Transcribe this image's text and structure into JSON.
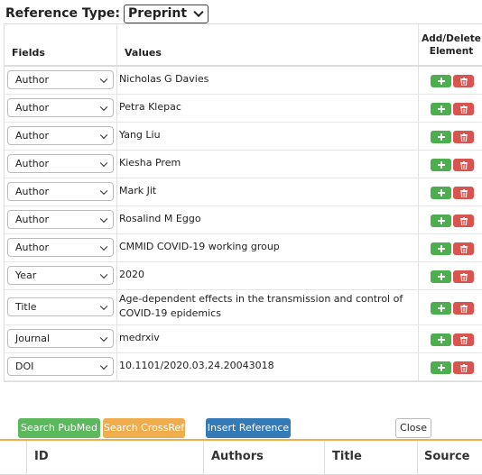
{
  "reference_type": {
    "label": "Reference Type:",
    "selected": "Preprint"
  },
  "table": {
    "headers": {
      "fields": "Fields",
      "values": "Values",
      "add_delete": "Add/Delete Element"
    },
    "rows": [
      {
        "field": "Author",
        "value": "Nicholas G Davies"
      },
      {
        "field": "Author",
        "value": "Petra Klepac"
      },
      {
        "field": "Author",
        "value": "Yang Liu"
      },
      {
        "field": "Author",
        "value": "Kiesha Prem"
      },
      {
        "field": "Author",
        "value": "Mark Jit"
      },
      {
        "field": "Author",
        "value": "Rosalind M Eggo"
      },
      {
        "field": "Author",
        "value": "CMMID COVID-19 working group"
      },
      {
        "field": "Year",
        "value": "2020"
      },
      {
        "field": "Title",
        "value": "Age-dependent effects in the transmission and control of COVID-19 epidemics"
      },
      {
        "field": "Journal",
        "value": "medrxiv"
      },
      {
        "field": "DOI",
        "value": "10.1101/2020.03.24.20043018"
      }
    ]
  },
  "buttons": {
    "search_pubmed": "Search PubMed",
    "search_crossref": "Search CrossRef",
    "insert_reference": "Insert Reference",
    "close": "Close"
  },
  "results_table": {
    "headers": {
      "id": "ID",
      "authors": "Authors",
      "title": "Title",
      "source": "Source"
    }
  },
  "colors": {
    "add_button": "#4cae4c",
    "delete_button": "#d9534f",
    "pubmed_button": "#5cb85c",
    "crossref_button": "#f0ad4e",
    "insert_button": "#337ab7"
  }
}
